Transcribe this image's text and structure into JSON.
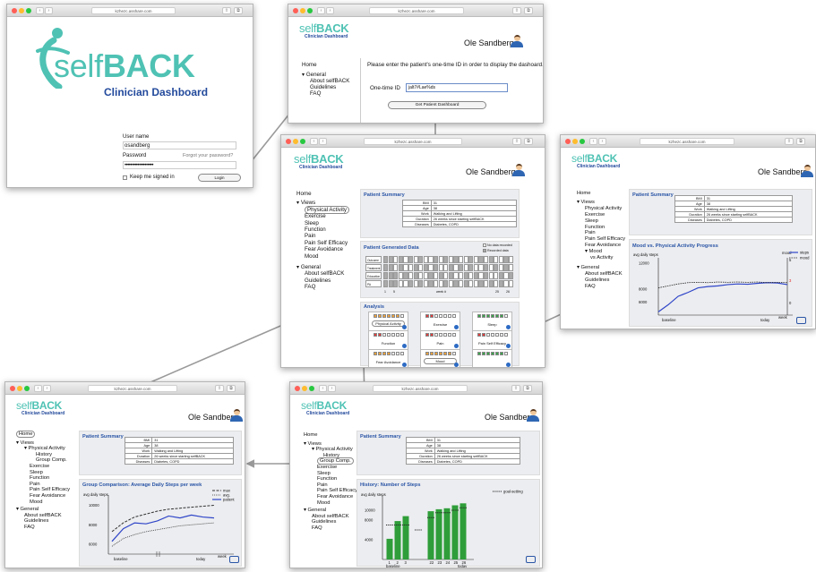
{
  "browser": {
    "url_main": "kzhezc.asshare.com"
  },
  "login": {
    "logo_word_self": "self",
    "logo_word_back": "BACK",
    "logo_sub": "Clinician Dashboard",
    "username_label": "User name",
    "username_value": "osandberg",
    "password_label": "Password",
    "forgot": "Forgot your password?",
    "password_value": "••••••••••••••••••••",
    "keep": "Keep me signed in",
    "login_btn": "Login"
  },
  "common": {
    "logo_self": "self",
    "logo_back": "BACK",
    "logo_sub": "Clinician Dashboard",
    "user_name": "Ole Sandberg",
    "nav_home": "Home",
    "nav_views": "Views",
    "nav_general": "General",
    "nav_about": "About selfBACK",
    "nav_guidelines": "Guidelines",
    "nav_faq": "FAQ",
    "nav_physical": "Physical Activity",
    "nav_exercise": "Exercise",
    "nav_sleep": "Sleep",
    "nav_function": "Function",
    "nav_pain": "Pain",
    "nav_pse": "Pain Self Efficacy",
    "nav_fear": "Fear Avoidance",
    "nav_mood": "Mood",
    "nav_vs_activity": "vs Activity",
    "nav_history": "History",
    "nav_group": "Group Comp.",
    "patient_summary": "Patient Summary",
    "summary": [
      {
        "k": "BMI",
        "v": "31"
      },
      {
        "k": "Age",
        "v": "38"
      },
      {
        "k": "Work",
        "v": "Walking and Lifting"
      },
      {
        "k": "Duration",
        "v": "26 weeks since starting selfBACK"
      },
      {
        "k": "Diseases",
        "v": "Diabetes, COPD"
      }
    ]
  },
  "onetime": {
    "prompt": "Please enter the patient's one-time ID in order to display the dashoard.",
    "id_label": "One-time ID",
    "id_value": "jalt7#Lae%ds",
    "button": "Get Patient Dashboard"
  },
  "center": {
    "pgd_title": "Patient Generated Data",
    "legend_none": "No data recorded",
    "legend_rec": "Recorded data",
    "pgd_rows": [
      "Outcome",
      "Treatment",
      "Education",
      "PA"
    ],
    "axis_start": "1",
    "axis_mid_a": "5",
    "axis_week": "week #",
    "axis_end_a": "25",
    "axis_end_b": "26",
    "analysis_title": "Analysis",
    "tiles": [
      {
        "label": "Physical Activity",
        "color": "#f2a33a",
        "filled": 6
      },
      {
        "label": "Exercise",
        "color": "#e23b3b",
        "filled": 2
      },
      {
        "label": "Sleep",
        "color": "#3aa64a",
        "filled": 6
      },
      {
        "label": "Function",
        "color": "#e23b3b",
        "filled": 2
      },
      {
        "label": "Pain",
        "color": "#e23b3b",
        "filled": 2
      },
      {
        "label": "Pain Self Efficacy",
        "color": "#e23b3b",
        "filled": 2
      },
      {
        "label": "Fear Avoidance",
        "color": "#f2a33a",
        "filled": 4
      },
      {
        "label": "Mood",
        "color": "#f2a33a",
        "filled": 6
      },
      {
        "label": "",
        "color": "#3aa64a",
        "filled": 6
      }
    ]
  },
  "mood": {
    "title": "Mood vs. Physical Activity Progress",
    "ylabel": "avg daily steps",
    "y_ticks": [
      "12000",
      "8000",
      "6000"
    ],
    "right_label": "mood",
    "right_ticks": [
      "5",
      "3",
      "0"
    ],
    "legend_steps": "steps",
    "legend_mood": "mood",
    "x_start": "baseline",
    "x_end": "today",
    "x_label": "week"
  },
  "group": {
    "title": "Group Comparison: Average Daily Steps per week",
    "ylabel": "avg daily steps",
    "y_ticks": [
      "10000",
      "8000",
      "6000"
    ],
    "legend_max": "max",
    "legend_avg": "avg.",
    "legend_patient": "patient",
    "x_start": "baseline",
    "x_end": "today",
    "x_label": "week"
  },
  "history": {
    "title": "History: Number of Steps",
    "legend_goal": "goal-setting",
    "ylabel": "avg daily steps",
    "y_ticks": [
      "10000",
      "8000",
      "4000"
    ],
    "x_labels": [
      "1",
      "2",
      "3",
      "22",
      "23",
      "24",
      "25",
      "26"
    ],
    "x_start": "baseline",
    "x_end": "today"
  },
  "chart_data": [
    {
      "type": "line",
      "title": "Mood vs. Physical Activity Progress",
      "x": [
        1,
        2,
        3,
        4,
        5,
        6,
        7,
        8,
        9,
        10,
        11,
        12,
        13,
        14
      ],
      "series": [
        {
          "name": "steps",
          "values": [
            4500,
            5600,
            6900,
            7500,
            8200,
            8400,
            8500,
            8700,
            8800,
            8750,
            8900,
            9000,
            8950,
            8700
          ]
        },
        {
          "name": "mood",
          "values": [
            8200,
            8500,
            8800,
            9000,
            9050,
            9000,
            9100,
            9050,
            9100,
            9050,
            9100,
            9000,
            9050,
            9000
          ]
        }
      ],
      "ylabel": "avg daily steps"
    },
    {
      "type": "line",
      "title": "Group Comparison: Average Daily Steps per week",
      "x": [
        1,
        2,
        3,
        4,
        5,
        6,
        7,
        8,
        9,
        10
      ],
      "series": [
        {
          "name": "max",
          "values": [
            7300,
            8200,
            8800,
            9100,
            9400,
            9600,
            9700,
            9800,
            9900,
            10000
          ]
        },
        {
          "name": "avg.",
          "values": [
            5800,
            6600,
            7000,
            7300,
            7500,
            7700,
            7900,
            8000,
            8100,
            8200
          ]
        },
        {
          "name": "patient",
          "values": [
            6300,
            7600,
            8200,
            8100,
            8400,
            8900,
            8700,
            9000,
            8800,
            8700
          ]
        }
      ],
      "ylabel": "avg daily steps"
    },
    {
      "type": "bar",
      "title": "History: Number of Steps",
      "categories": [
        "1",
        "2",
        "3",
        "22",
        "23",
        "24",
        "25",
        "26"
      ],
      "values": [
        4200,
        7800,
        8800,
        9800,
        10200,
        10400,
        11000,
        11400
      ],
      "series": [
        {
          "name": "goal-setting",
          "values": [
            7000,
            7000,
            7000,
            8500,
            9500,
            9500,
            10000,
            10500
          ]
        }
      ],
      "ylabel": "avg daily steps"
    }
  ]
}
